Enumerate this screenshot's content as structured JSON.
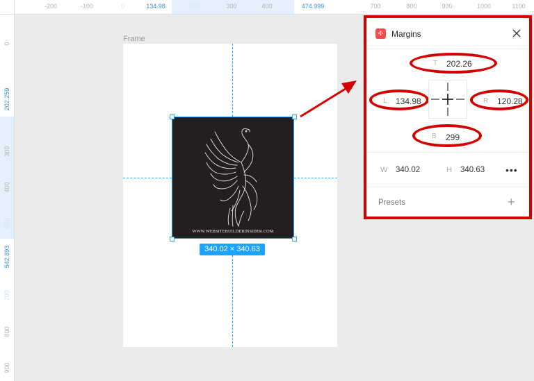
{
  "ruler": {
    "top_ticks": [
      "-200",
      "-100",
      "0",
      "134.98",
      "200",
      "300",
      "400",
      "474.999",
      "700",
      "800",
      "900",
      "1000",
      "1100"
    ],
    "left_ticks": [
      "0",
      "202.259",
      "300",
      "400",
      "500",
      "542.893",
      "700",
      "800",
      "900"
    ]
  },
  "canvas": {
    "frame_label": "Frame",
    "image_caption": "WWW.WEBSITEBUILDERINSIDER.COM",
    "size_badge": "340.02 × 340.63"
  },
  "panel": {
    "title": "Margins",
    "margins": {
      "top_label": "T",
      "top": "202.26",
      "left_label": "L",
      "left": "134.98",
      "right_label": "R",
      "right": "120.28",
      "bottom_label": "B",
      "bottom": "299"
    },
    "width_label": "W",
    "width": "340.02",
    "height_label": "H",
    "height": "340.63",
    "more": "•••",
    "presets_label": "Presets",
    "add": "+"
  },
  "colors": {
    "accent": "#1aa3ff",
    "annotation": "#d40000",
    "canvas_bg": "#ebebeb",
    "plugin_icon": "#f24e4e"
  },
  "icons": [
    "margins-plugin-icon",
    "close-icon",
    "crosshair-icon",
    "more-icon",
    "plus-icon"
  ]
}
